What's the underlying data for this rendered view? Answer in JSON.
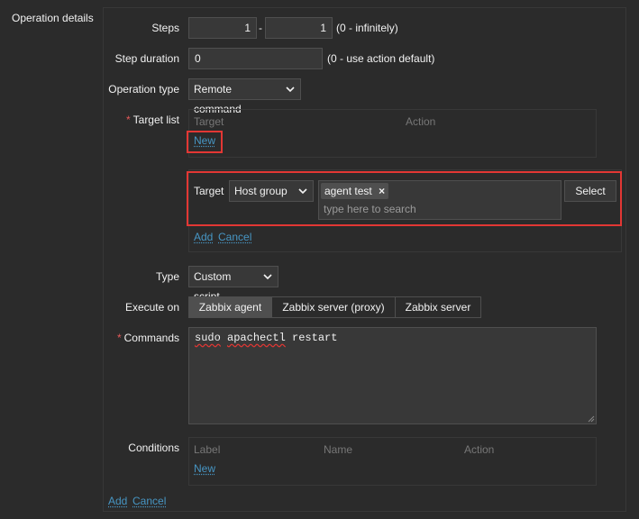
{
  "section_label": "Operation details",
  "steps": {
    "label": "Steps",
    "from": "1",
    "separator": "-",
    "to": "1",
    "hint": "(0 - infinitely)"
  },
  "step_duration": {
    "label": "Step duration",
    "value": "0",
    "hint": "(0 - use action default)"
  },
  "operation_type": {
    "label": "Operation type",
    "value": "Remote command"
  },
  "target_list": {
    "required_mark": "*",
    "label": "Target list",
    "col_target": "Target",
    "col_action": "Action",
    "new_link": "New"
  },
  "target_editor": {
    "label": "Target",
    "type_value": "Host group",
    "tag": "agent test",
    "tag_remove": "×",
    "search_placeholder": "type here to search",
    "select_button": "Select",
    "add_link": "Add",
    "cancel_link": "Cancel"
  },
  "type": {
    "label": "Type",
    "value": "Custom script"
  },
  "execute_on": {
    "label": "Execute on",
    "options": [
      "Zabbix agent",
      "Zabbix server (proxy)",
      "Zabbix server"
    ],
    "selected": "Zabbix agent"
  },
  "commands": {
    "required_mark": "*",
    "label": "Commands",
    "value_words": [
      "sudo",
      "apachectl",
      "restart"
    ]
  },
  "conditions": {
    "label": "Conditions",
    "col_label": "Label",
    "col_name": "Name",
    "col_action": "Action",
    "new_link": "New"
  },
  "footer": {
    "add_link": "Add",
    "cancel_link": "Cancel"
  },
  "colors": {
    "background": "#2b2b2b",
    "input_bg": "#383838",
    "link": "#4796c4",
    "highlight_border": "#e33734",
    "required": "#e45959"
  }
}
